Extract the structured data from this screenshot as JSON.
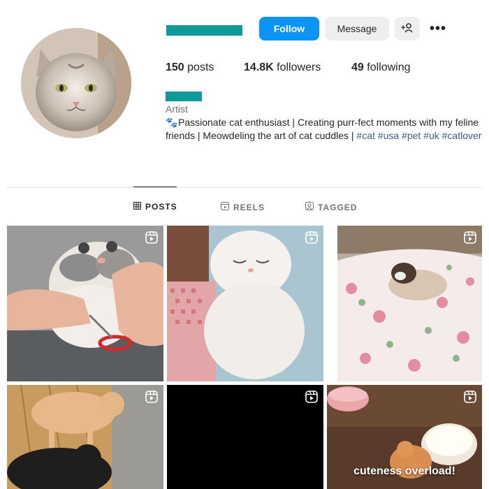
{
  "header": {
    "follow_label": "Follow",
    "message_label": "Message",
    "adduser_label": "+",
    "more_label": "•••"
  },
  "stats": {
    "posts_count": "150",
    "posts_label": "posts",
    "followers_count": "14.8K",
    "followers_label": "followers",
    "following_count": "49",
    "following_label": "following"
  },
  "bio": {
    "category": "Artist",
    "text_1": "Passionate cat enthusiast | Creating purr-fect moments with my feline friends | Meowdeling the art of cat cuddles | ",
    "hashtags": [
      "#cat",
      "#usa",
      "#pet",
      "#uk",
      "#catlover"
    ]
  },
  "tabs": [
    {
      "label": "POSTS",
      "active": true
    },
    {
      "label": "REELS",
      "active": false
    },
    {
      "label": "TAGGED",
      "active": false
    }
  ],
  "grid": [
    {
      "type": "reel",
      "overlay": ""
    },
    {
      "type": "reel",
      "overlay": ""
    },
    {
      "type": "reel",
      "overlay": ""
    },
    {
      "type": "reel",
      "overlay": ""
    },
    {
      "type": "reel",
      "overlay": ""
    },
    {
      "type": "reel",
      "overlay": "cuteness overload!"
    }
  ],
  "colors": {
    "accent": "#0a95f6",
    "redacted": "#0f9a9a",
    "hashtag": "#3b5c8f",
    "muted": "#737373"
  }
}
